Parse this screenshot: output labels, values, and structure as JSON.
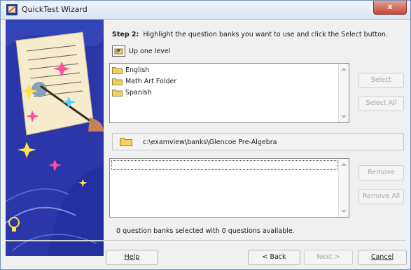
{
  "window": {
    "title": "QuickTest Wizard",
    "close_label": "x"
  },
  "step": {
    "bold": "Step 2:",
    "text": "Highlight the question banks you want to use and click the Select button."
  },
  "up_level": {
    "label": "Up one level"
  },
  "folders": [
    {
      "label": "English"
    },
    {
      "label": "Math Art Folder"
    },
    {
      "label": "Spanish"
    }
  ],
  "buttons": {
    "select": "Select",
    "select_all": "Select All",
    "remove": "Remove",
    "remove_all": "Remove All",
    "help": "Help",
    "back": "< Back",
    "next": "Next >",
    "cancel": "Cancel"
  },
  "path": {
    "text": "c:\\examview\\banks\\Glencoe Pre-Algebra"
  },
  "status": {
    "text": "0 question banks selected with 0 questions available."
  },
  "colors": {
    "art_background": "#2b37a8",
    "folder_yellow": "#f3d05a"
  },
  "icons": [
    "quicktest-app-icon",
    "up-one-level-icon",
    "folder-icon",
    "lightbulb-icon"
  ]
}
